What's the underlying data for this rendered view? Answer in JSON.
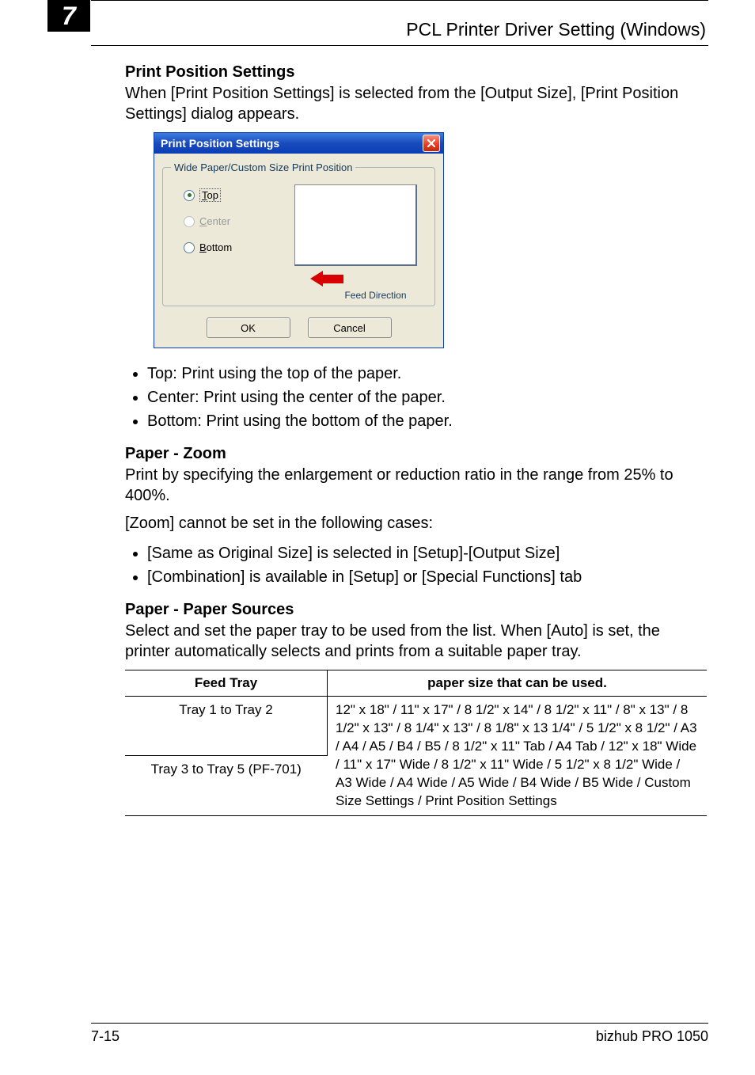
{
  "header": {
    "chapter_number": "7",
    "title": "PCL Printer Driver Setting (Windows)"
  },
  "sections": {
    "print_position": {
      "heading": "Print Position Settings",
      "intro": "When [Print Position Settings] is selected from the [Output Size], [Print Position Settings] dialog appears.",
      "dialog": {
        "title": "Print Position Settings",
        "close_icon": "close-icon",
        "group_label": "Wide Paper/Custom Size Print Position",
        "radios": [
          {
            "label_underline": "T",
            "label_rest": "op",
            "selected": true,
            "enabled": true
          },
          {
            "label_underline": "C",
            "label_rest": "enter",
            "selected": false,
            "enabled": false
          },
          {
            "label_underline": "B",
            "label_rest": "ottom",
            "selected": false,
            "enabled": true
          }
        ],
        "feed_direction_label": "Feed Direction",
        "ok_label": "OK",
        "cancel_label": "Cancel"
      },
      "bullets": [
        "Top: Print using the top of the paper.",
        "Center: Print using the center of the paper.",
        "Bottom: Print using the bottom of the paper."
      ]
    },
    "paper_zoom": {
      "heading": "Paper - Zoom",
      "intro": "Print by specifying the enlargement or reduction ratio in the range from 25% to 400%.",
      "note": "[Zoom] cannot be set in the following cases:",
      "bullets": [
        "[Same as Original Size] is selected in [Setup]-[Output Size]",
        "[Combination] is available in [Setup] or [Special Functions] tab"
      ]
    },
    "paper_sources": {
      "heading": "Paper - Paper Sources",
      "intro": "Select and set the paper tray to be used from the list. When [Auto] is set, the printer automatically selects and prints from a suitable paper tray.",
      "table": {
        "headers": [
          "Feed Tray",
          "paper size that can be used."
        ],
        "rows": [
          {
            "col1": "Tray 1 to Tray 2"
          },
          {
            "col1": "Tray 3 to Tray 5 (PF-701)"
          }
        ],
        "col2_shared": "12\" x 18\" / 11\" x 17\" / 8 1/2\" x 14\" / 8 1/2\" x 11\" / 8\" x 13\" / 8 1/2\" x 13\" / 8 1/4\" x 13\" / 8 1/8\" x 13 1/4\" / 5 1/2\" x 8 1/2\" / A3 / A4 / A5 / B4 / B5 / 8 1/2\" x 11\" Tab / A4 Tab / 12\" x 18\" Wide / 11\" x 17\" Wide / 8 1/2\" x 11\" Wide / 5 1/2\" x 8 1/2\" Wide / A3 Wide / A4 Wide / A5 Wide / B4 Wide / B5 Wide / Custom Size Settings / Print Position Settings"
      }
    }
  },
  "footer": {
    "page": "7-15",
    "product": "bizhub PRO 1050"
  }
}
